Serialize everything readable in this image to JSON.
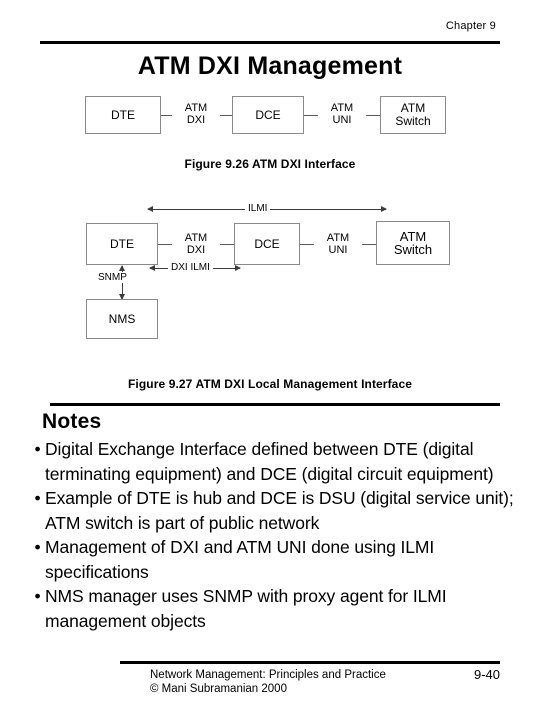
{
  "header": {
    "chapter": "Chapter 9",
    "title": "ATM DXI Management"
  },
  "figure1": {
    "caption": "Figure 9.26 ATM DXI Interface",
    "nodes": [
      {
        "label": "DTE"
      },
      {
        "label": "DCE"
      },
      {
        "label": "ATM\nSwitch"
      }
    ],
    "node_dte": "DTE",
    "node_dce": "DCE",
    "node_switch_line1": "ATM",
    "node_switch_line2": "Switch",
    "link_dxi_line1": "ATM",
    "link_dxi_line2": "DXI",
    "link_uni_line1": "ATM",
    "link_uni_line2": "UNI"
  },
  "figure2": {
    "caption": "Figure 9.27 ATM DXI Local Management Interface",
    "node_dte": "DTE",
    "node_dce": "DCE",
    "node_switch_line1": "ATM",
    "node_switch_line2": "Switch",
    "node_nms": "NMS",
    "link_dxi_line1": "ATM",
    "link_dxi_line2": "DXI",
    "link_uni_line1": "ATM",
    "link_uni_line2": "UNI",
    "arrow_ilmi": "ILMI",
    "arrow_dxi_ilmi": "DXI ILMI",
    "arrow_snmp": "SNMP"
  },
  "notes": {
    "heading": "Notes",
    "bullet": "•",
    "items": [
      "Digital Exchange Interface defined between DTE (digital terminating equipment) and DCE (digital circuit equipment)",
      "Example of DTE is hub and DCE is DSU (digital service unit); ATM switch is part of public network",
      "Management of DXI and ATM UNI done using ILMI specifications",
      "NMS manager uses SNMP with proxy agent for ILMI management objects"
    ]
  },
  "footer": {
    "credit_line1": "Network Management: Principles and Practice",
    "credit_line2": "© Mani Subramanian 2000",
    "page": "9-40"
  }
}
